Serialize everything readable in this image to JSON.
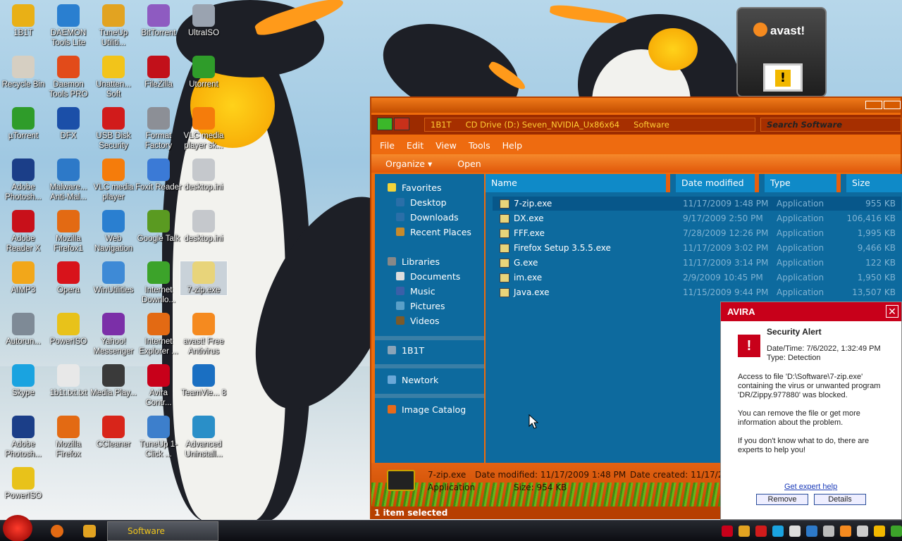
{
  "desktop": {
    "icons": [
      {
        "label": "1B1T",
        "icon": "app-icon",
        "color": "#e9b016"
      },
      {
        "label": "DAEMON Tools Lite",
        "icon": "lightning-icon",
        "color": "#2a7fd0"
      },
      {
        "label": "TuneUp Utiliti...",
        "icon": "wrench-icon",
        "color": "#e2a321"
      },
      {
        "label": "BitTorrent",
        "icon": "bittorrent-icon",
        "color": "#8e5bc1"
      },
      {
        "label": "UltraISO",
        "icon": "disc-icon",
        "color": "#9aa3b0"
      },
      {
        "label": "Recycle Bin",
        "icon": "recycle-bin-icon",
        "color": "#d6cfc2"
      },
      {
        "label": "Daemon Tools PRO",
        "icon": "lightning-icon",
        "color": "#e24b1a"
      },
      {
        "label": "Unatten... Soft",
        "icon": "star-icon",
        "color": "#f2c41a"
      },
      {
        "label": "FileZilla",
        "icon": "filezilla-icon",
        "color": "#c2101a"
      },
      {
        "label": "Utorrent",
        "icon": "utorrent-icon",
        "color": "#2f9c2a"
      },
      {
        "label": "µTorrent",
        "icon": "utorrent-icon",
        "color": "#2f9c2a"
      },
      {
        "label": "DFX",
        "icon": "dfx-icon",
        "color": "#1b4fa8"
      },
      {
        "label": "USB Disk Security",
        "icon": "shield-icon",
        "color": "#d11b1b"
      },
      {
        "label": "Format Factory",
        "icon": "gear-icon",
        "color": "#8c8f96"
      },
      {
        "label": "VLC media player sk...",
        "icon": "vlc-icon",
        "color": "#f57c0b"
      },
      {
        "label": "Adobe Photosh...",
        "icon": "photoshop-icon",
        "color": "#1b3e88"
      },
      {
        "label": "Malware... Anti-Mal...",
        "icon": "malwarebytes-icon",
        "color": "#2d79c8"
      },
      {
        "label": "VLC media player",
        "icon": "vlc-icon",
        "color": "#f57c0b"
      },
      {
        "label": "Foxit Reader",
        "icon": "foxit-icon",
        "color": "#3b7ad6"
      },
      {
        "label": "desktop.ini",
        "icon": "settings-file-icon",
        "color": "#c5c8cc"
      },
      {
        "label": "Adobe Reader X",
        "icon": "adobe-reader-icon",
        "color": "#c8101a"
      },
      {
        "label": "Mozilla Firefox1",
        "icon": "firefox-icon",
        "color": "#e36a13"
      },
      {
        "label": "Web Navigation",
        "icon": "globe-icon",
        "color": "#2a7fd0"
      },
      {
        "label": "Google Talk",
        "icon": "talk-icon",
        "color": "#5a9a21"
      },
      {
        "label": "desktop.ini",
        "icon": "settings-file-icon",
        "color": "#c5c8cc"
      },
      {
        "label": "AIMP3",
        "icon": "aimp-icon",
        "color": "#f2a71a"
      },
      {
        "label": "Opera",
        "icon": "opera-icon",
        "color": "#d8131b"
      },
      {
        "label": "WinUtilities",
        "icon": "winutilities-icon",
        "color": "#3e8ad6"
      },
      {
        "label": "Internet Downlo...",
        "icon": "download-icon",
        "color": "#3ca32a"
      },
      {
        "label": "7-zip.exe",
        "icon": "7zip-icon",
        "color": "#e8d47a"
      },
      {
        "label": "Autorun...",
        "icon": "autoruns-icon",
        "color": "#7e8a96"
      },
      {
        "label": "PowerISO",
        "icon": "disc-icon",
        "color": "#e8c21a"
      },
      {
        "label": "Yahoo! Messenger",
        "icon": "yahoo-icon",
        "color": "#7b2fa8"
      },
      {
        "label": "Internet Explorer ...",
        "icon": "firefox-icon",
        "color": "#e36a13"
      },
      {
        "label": "avast! Free Antivirus",
        "icon": "avast-icon",
        "color": "#f58a1f"
      },
      {
        "label": "Skype",
        "icon": "skype-icon",
        "color": "#1aa3e0"
      },
      {
        "label": "1b1t.txt.txt",
        "icon": "text-file-icon",
        "color": "#e8e8e8"
      },
      {
        "label": "Media Play...",
        "icon": "media-player-icon",
        "color": "#3a3a3a"
      },
      {
        "label": "Avira Contr...",
        "icon": "avira-icon",
        "color": "#c8001a"
      },
      {
        "label": "TeamVie... 8",
        "icon": "teamviewer-icon",
        "color": "#1a6fc2"
      },
      {
        "label": "Adobe Photosh...",
        "icon": "photoshop-icon",
        "color": "#1b3e88"
      },
      {
        "label": "Mozilla Firefox",
        "icon": "firefox-icon",
        "color": "#e36a13"
      },
      {
        "label": "CCleaner",
        "icon": "ccleaner-icon",
        "color": "#d8251a"
      },
      {
        "label": "TuneUp 1-Click ...",
        "icon": "tuneup-icon",
        "color": "#3d7fcc"
      },
      {
        "label": "Advanced Uninstall...",
        "icon": "uninstaller-icon",
        "color": "#2a8fc8"
      },
      {
        "label": "PowerISO",
        "icon": "disc-icon",
        "color": "#e8c21a"
      }
    ]
  },
  "avast_gadget": {
    "brand": "avast!",
    "alert_symbol": "!"
  },
  "explorer": {
    "address": [
      "1B1T",
      "CD Drive (D:) Seven_NVIDIA_Ux86x64",
      "Software"
    ],
    "search_placeholder": "Search Software",
    "menu": [
      "File",
      "Edit",
      "View",
      "Tools",
      "Help"
    ],
    "toolbar": {
      "organize": "Organize ▾",
      "open": "Open"
    },
    "nav": {
      "favorites": "Favorites",
      "desktop": "Desktop",
      "downloads": "Downloads",
      "recent": "Recent Places",
      "libraries": "Libraries",
      "documents": "Documents",
      "music": "Music",
      "pictures": "Pictures",
      "videos": "Videos",
      "computer": "1B1T",
      "network": "Newtork",
      "catalog": "Image Catalog"
    },
    "columns": {
      "name": "Name",
      "date": "Date modified",
      "type": "Type",
      "size": "Size"
    },
    "files": [
      {
        "name": "7-zip.exe",
        "date": "11/17/2009 1:48 PM",
        "type": "Application",
        "size": "955 KB"
      },
      {
        "name": "DX.exe",
        "date": "9/17/2009 2:50 PM",
        "type": "Application",
        "size": "106,416 KB"
      },
      {
        "name": "FFF.exe",
        "date": "7/28/2009 12:26 PM",
        "type": "Application",
        "size": "1,995 KB"
      },
      {
        "name": "Firefox Setup 3.5.5.exe",
        "date": "11/17/2009 3:02 PM",
        "type": "Application",
        "size": "9,466 KB"
      },
      {
        "name": "G.exe",
        "date": "11/17/2009 3:14 PM",
        "type": "Application",
        "size": "122 KB"
      },
      {
        "name": "im.exe",
        "date": "2/9/2009 10:45 PM",
        "type": "Application",
        "size": "1,950 KB"
      },
      {
        "name": "Java.exe",
        "date": "11/15/2009 9:44 PM",
        "type": "Application",
        "size": "13,507 KB"
      }
    ],
    "details": {
      "name": "7-zip.exe",
      "type": "Application",
      "modified": "Date modified: 11/17/2009 1:48 PM",
      "size": "Size: 954 KB",
      "created": "Date created: 11/17/20"
    },
    "status": "1 item selected"
  },
  "avira": {
    "brand": "AVIRA",
    "title": "Security Alert",
    "datetime": "Date/Time: 7/6/2022, 1:32:49 PM",
    "type": "Type: Detection",
    "msg1": "Access to file 'D:\\Software\\7-zip.exe' containing the virus or unwanted program 'DR/Zippy.977880' was blocked.",
    "msg2": "You can remove the file or get more information about the problem.",
    "msg3": "If you don't know what to do, there are experts to help you!",
    "link": "Get expert help",
    "remove": "Remove",
    "details": "Details"
  },
  "taskbar": {
    "task": "Software"
  }
}
